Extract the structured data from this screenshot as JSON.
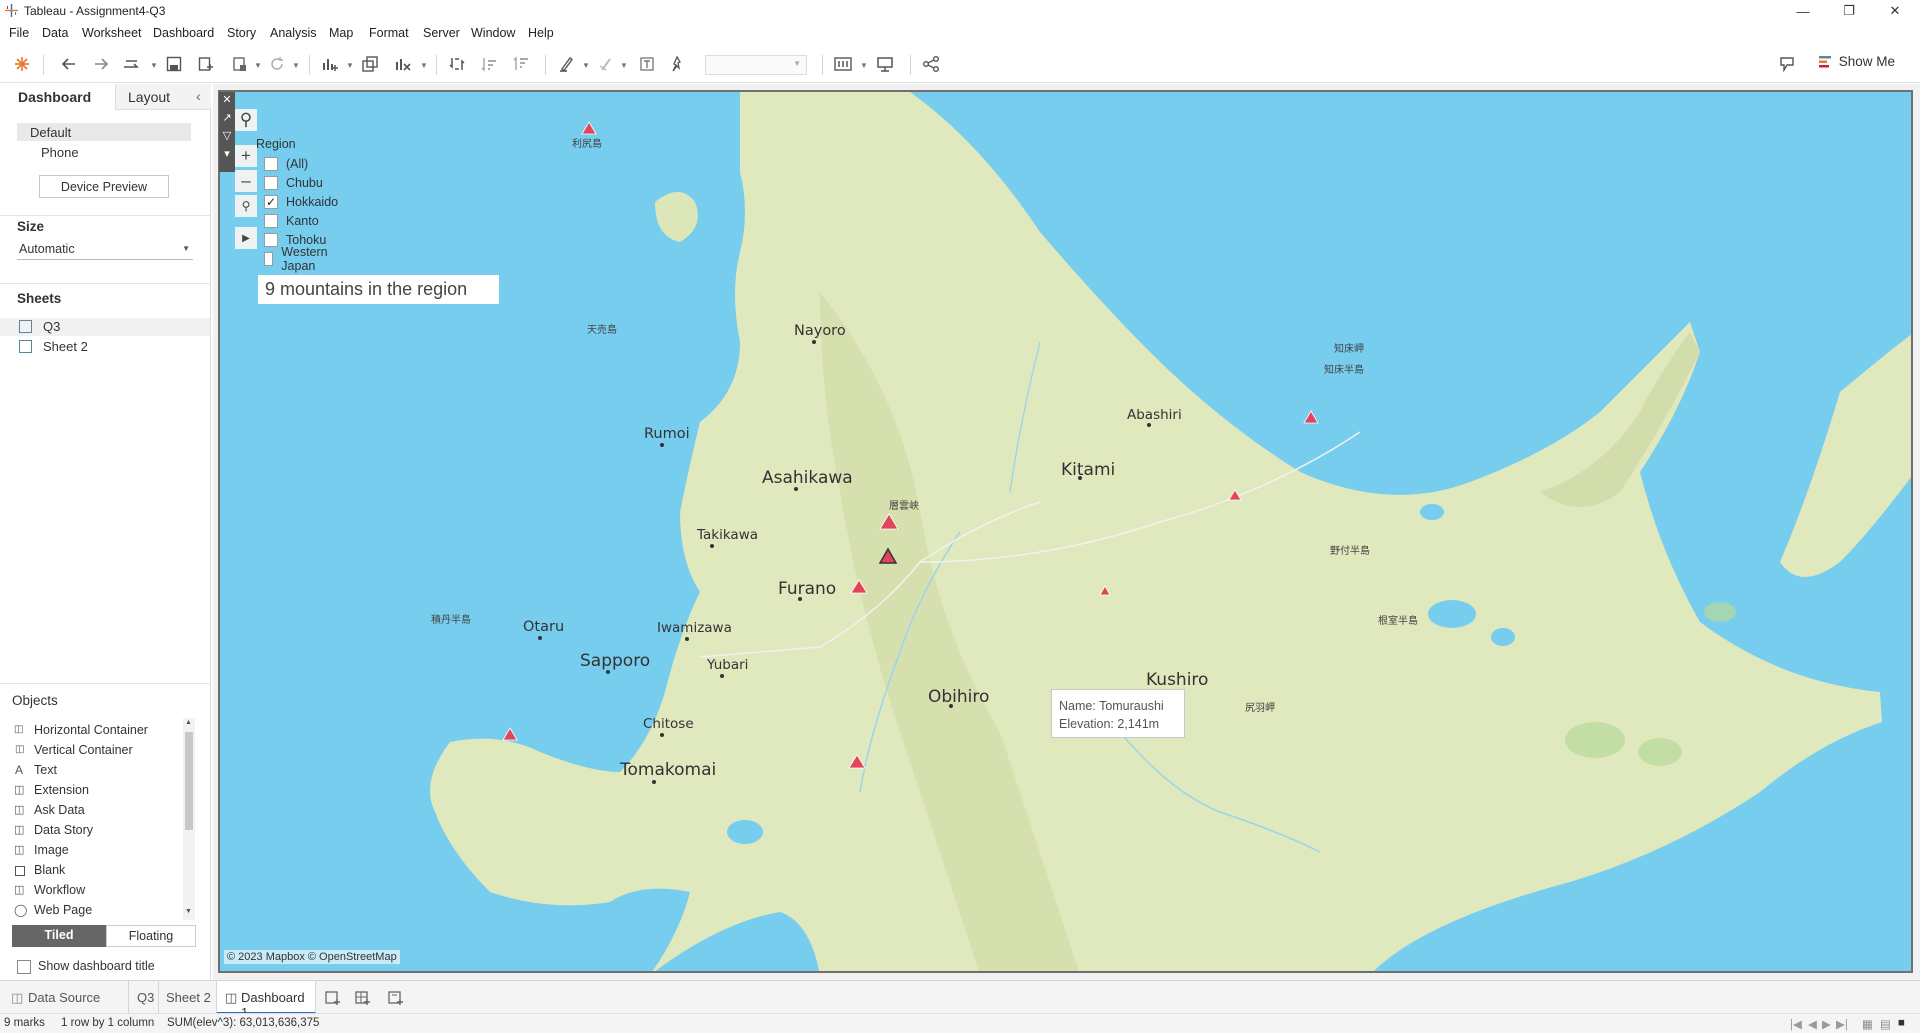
{
  "window": {
    "title": "Tableau - Assignment4-Q3"
  },
  "menu": [
    "File",
    "Data",
    "Worksheet",
    "Dashboard",
    "Story",
    "Analysis",
    "Map",
    "Format",
    "Server",
    "Window",
    "Help"
  ],
  "toolbar": {
    "show_me": "Show Me"
  },
  "left_pane": {
    "tabs": {
      "dashboard": "Dashboard",
      "layout": "Layout"
    },
    "devices": {
      "default": "Default",
      "phone": "Phone",
      "preview_button": "Device Preview"
    },
    "size": {
      "heading": "Size",
      "value": "Automatic"
    },
    "sheets": {
      "heading": "Sheets",
      "items": [
        "Q3",
        "Sheet 2"
      ]
    },
    "objects": {
      "heading": "Objects",
      "items": [
        "Horizontal Container",
        "Vertical Container",
        "Text",
        "Extension",
        "Ask Data",
        "Data Story",
        "Image",
        "Blank",
        "Workflow",
        "Web Page"
      ],
      "tiled": "Tiled",
      "floating": "Floating",
      "show_title": "Show dashboard title"
    }
  },
  "legend": {
    "title": "Region",
    "items": [
      {
        "label": "(All)",
        "checked": false
      },
      {
        "label": "Chubu",
        "checked": false
      },
      {
        "label": "Hokkaido",
        "checked": true
      },
      {
        "label": "Kanto",
        "checked": false
      },
      {
        "label": "Tohoku",
        "checked": false
      },
      {
        "label": "Western Japan",
        "checked": false
      }
    ]
  },
  "summary_text": "9 mountains in the region",
  "map": {
    "cities": [
      {
        "name": "Nayoro"
      },
      {
        "name": "Rumoi"
      },
      {
        "name": "Asahikawa"
      },
      {
        "name": "Takikawa"
      },
      {
        "name": "Furano"
      },
      {
        "name": "Otaru"
      },
      {
        "name": "Sapporo"
      },
      {
        "name": "Iwamizawa"
      },
      {
        "name": "Yubari"
      },
      {
        "name": "Chitose"
      },
      {
        "name": "Tomakomai"
      },
      {
        "name": "Obihiro"
      },
      {
        "name": "Kitami"
      },
      {
        "name": "Abashiri"
      },
      {
        "name": "Kushiro"
      }
    ],
    "small_labels": [
      "利尻島",
      "天売島",
      "層雲峡",
      "知床岬",
      "知床半島",
      "野付半島",
      "根室半島",
      "尻羽岬",
      "積丹半島"
    ],
    "attribution": "© 2023 Mapbox © OpenStreetMap",
    "mark_color": "#e0455b"
  },
  "tooltip": {
    "name_line": "Name: Tomuraushi",
    "elev_line": "Elevation: 2,141m"
  },
  "tabs": {
    "data_source": "Data Source",
    "q3": "Q3",
    "sheet2": "Sheet 2",
    "dashboard1": "Dashboard 1"
  },
  "status": {
    "marks": "9 marks",
    "rows": "1 row by 1 column",
    "sum": "SUM(elev^3): 63,013,636,375"
  }
}
